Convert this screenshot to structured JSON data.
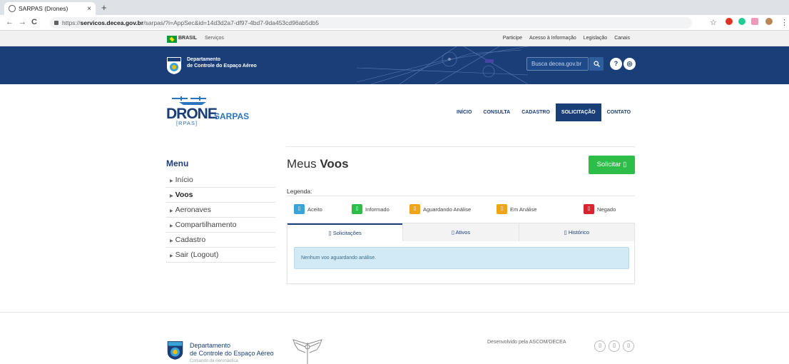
{
  "browser": {
    "tab_title": "SARPAS (Drones)",
    "tab_close": "×",
    "new_tab": "+",
    "url_prefix": "https://",
    "url_domain": "servicos.decea.gov.br",
    "url_rest": "/sarpas/?i=AppSec&id=14d3d2a7-df97-4bd7-9da453cd96ab5db5",
    "back": "←",
    "forward": "→",
    "reload": "C",
    "star": "☆",
    "menu": "⋮"
  },
  "gov_bar": {
    "brasil": "BRASIL",
    "servicos": "Serviços",
    "links": [
      "Participe",
      "Acesso à Informação",
      "Legislação",
      "Canais"
    ]
  },
  "header": {
    "dept_line1": "Departamento",
    "dept_line2": "de Controle do Espaço Aéreo",
    "search_placeholder": "Busca decea.gov.br",
    "help_icon": "?",
    "chat_icon": "◎"
  },
  "logo": {
    "drone": "DRONE",
    "sarpas": "SARPAS",
    "rpas": "[RPAS]"
  },
  "nav": {
    "items": [
      "INÍCIO",
      "CONSULTA",
      "CADASTRO",
      "SOLICITAÇÃO",
      "CONTATO"
    ],
    "active": "SOLICITAÇÃO"
  },
  "sidebar": {
    "title": "Menu",
    "items": [
      "Início",
      "Voos",
      "Aeronaves",
      "Compartilhamento",
      "Cadastro",
      "Sair (Logout)"
    ],
    "selected": "Voos"
  },
  "main": {
    "title_prefix": "Meus",
    "title_bold": "Voos",
    "solicitar_label": "Solicitar ▯",
    "legenda_label": "Legenda:",
    "legend": [
      {
        "label": "Aceito",
        "color": "#3aa3d8"
      },
      {
        "label": "Informado",
        "color": "#2ebd48"
      },
      {
        "label": "Aguardando Análise",
        "color": "#f0a418"
      },
      {
        "label": "Em Análise",
        "color": "#f0a418"
      },
      {
        "label": "Negado",
        "color": "#d9232e"
      }
    ],
    "legend_glyph": "▯",
    "tabs": [
      "▯ Solicitações",
      "▯ Ativos",
      "▯ Histórico"
    ],
    "alert": "Nenhum voo aguardando análise."
  },
  "footer": {
    "dept_line1": "Departamento",
    "dept_line2": "de Controle do Espaço Aéreo",
    "sub": "Comando da Aeronáutica",
    "developed_by": "Desenvolvido pela ASCOM/DECEA",
    "social_glyph": "▯"
  }
}
